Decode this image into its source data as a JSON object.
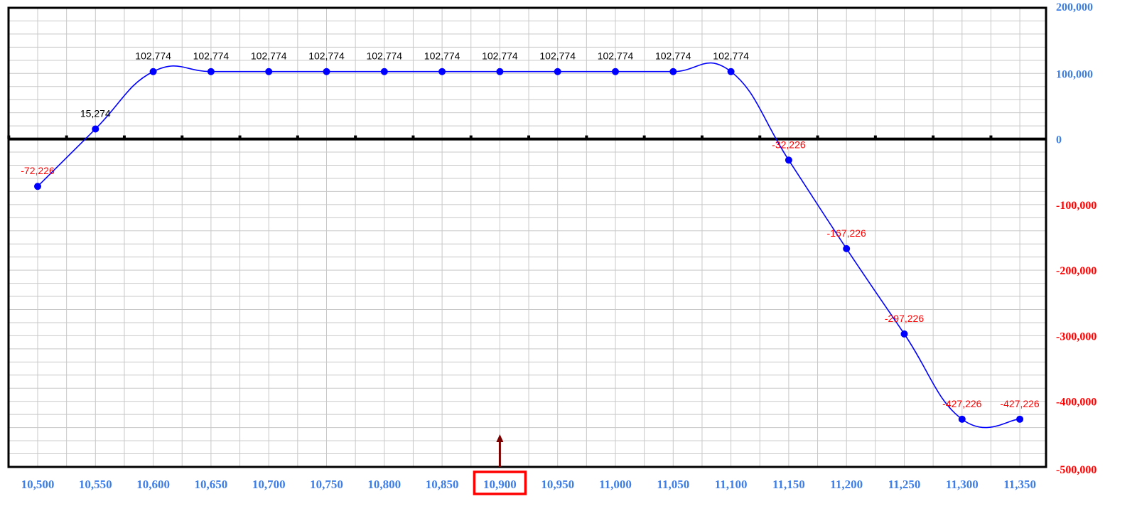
{
  "chart_data": {
    "type": "line",
    "x": [
      10500,
      10550,
      10600,
      10650,
      10700,
      10750,
      10800,
      10850,
      10900,
      10950,
      11000,
      11050,
      11100,
      11150,
      11200,
      11250,
      11300,
      11350
    ],
    "x_tick_labels": [
      "10,500",
      "10,550",
      "10,600",
      "10,650",
      "10,700",
      "10,750",
      "10,800",
      "10,850",
      "10,900",
      "10,950",
      "11,000",
      "11,050",
      "11,100",
      "11,150",
      "11,200",
      "11,250",
      "11,300",
      "11,350"
    ],
    "series": [
      {
        "values": [
          -72226,
          15274,
          102774,
          102774,
          102774,
          102774,
          102774,
          102774,
          102774,
          102774,
          102774,
          102774,
          102774,
          -32226,
          -167226,
          -297226,
          -427226,
          -427226
        ],
        "point_labels": [
          "-72,226",
          "15,274",
          "102,774",
          "102,774",
          "102,774",
          "102,774",
          "102,774",
          "102,774",
          "102,774",
          "102,774",
          "102,774",
          "102,774",
          "102,774",
          "-32,226",
          "-167,226",
          "-297,226",
          "-427,226",
          "-427,226"
        ]
      }
    ],
    "ylim": [
      -500000,
      200000
    ],
    "y_ticks": [
      200000,
      100000,
      0,
      -100000,
      -200000,
      -300000,
      -400000,
      -500000
    ],
    "y_tick_labels": [
      "200,000",
      "100,000",
      "0",
      "-100,000",
      "-200,000",
      "-300,000",
      "-400,000",
      "-500,000"
    ],
    "y_axis_side": "right",
    "grid": true,
    "highlighted_x": 10900,
    "colors": {
      "line": "#0000ff",
      "positive_label": "#000000",
      "negative_label": "#ff0000",
      "x_tick": "#3d7ee8",
      "y_tick_positive": "#3d7ee8",
      "y_tick_negative": "#ff0000",
      "highlight_box": "#ff0000",
      "arrow": "#7a0000",
      "grid": "#c8c8c8",
      "zero_line": "#000000"
    }
  }
}
